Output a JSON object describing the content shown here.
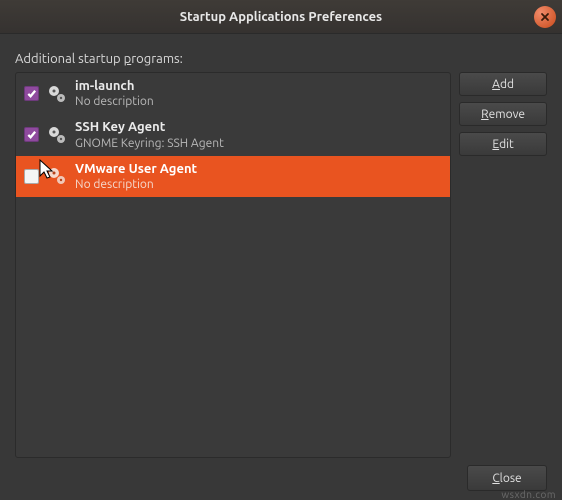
{
  "window": {
    "title": "Startup Applications Preferences"
  },
  "list": {
    "label_pre": "Additional startup ",
    "label_mnemonic": "p",
    "label_post": "rograms:",
    "items": [
      {
        "name": "im-launch",
        "desc": "No description",
        "checked": true,
        "selected": false
      },
      {
        "name": "SSH Key Agent",
        "desc": "GNOME Keyring: SSH Agent",
        "checked": true,
        "selected": false
      },
      {
        "name": "VMware User Agent",
        "desc": "No description",
        "checked": false,
        "selected": true
      }
    ]
  },
  "buttons": {
    "add": {
      "mnemonic": "A",
      "rest": "dd"
    },
    "remove": {
      "mnemonic": "R",
      "rest": "emove"
    },
    "edit": {
      "mnemonic": "E",
      "rest": "dit"
    },
    "close": {
      "mnemonic": "C",
      "rest": "lose"
    }
  },
  "watermark": "wsxdn.com"
}
